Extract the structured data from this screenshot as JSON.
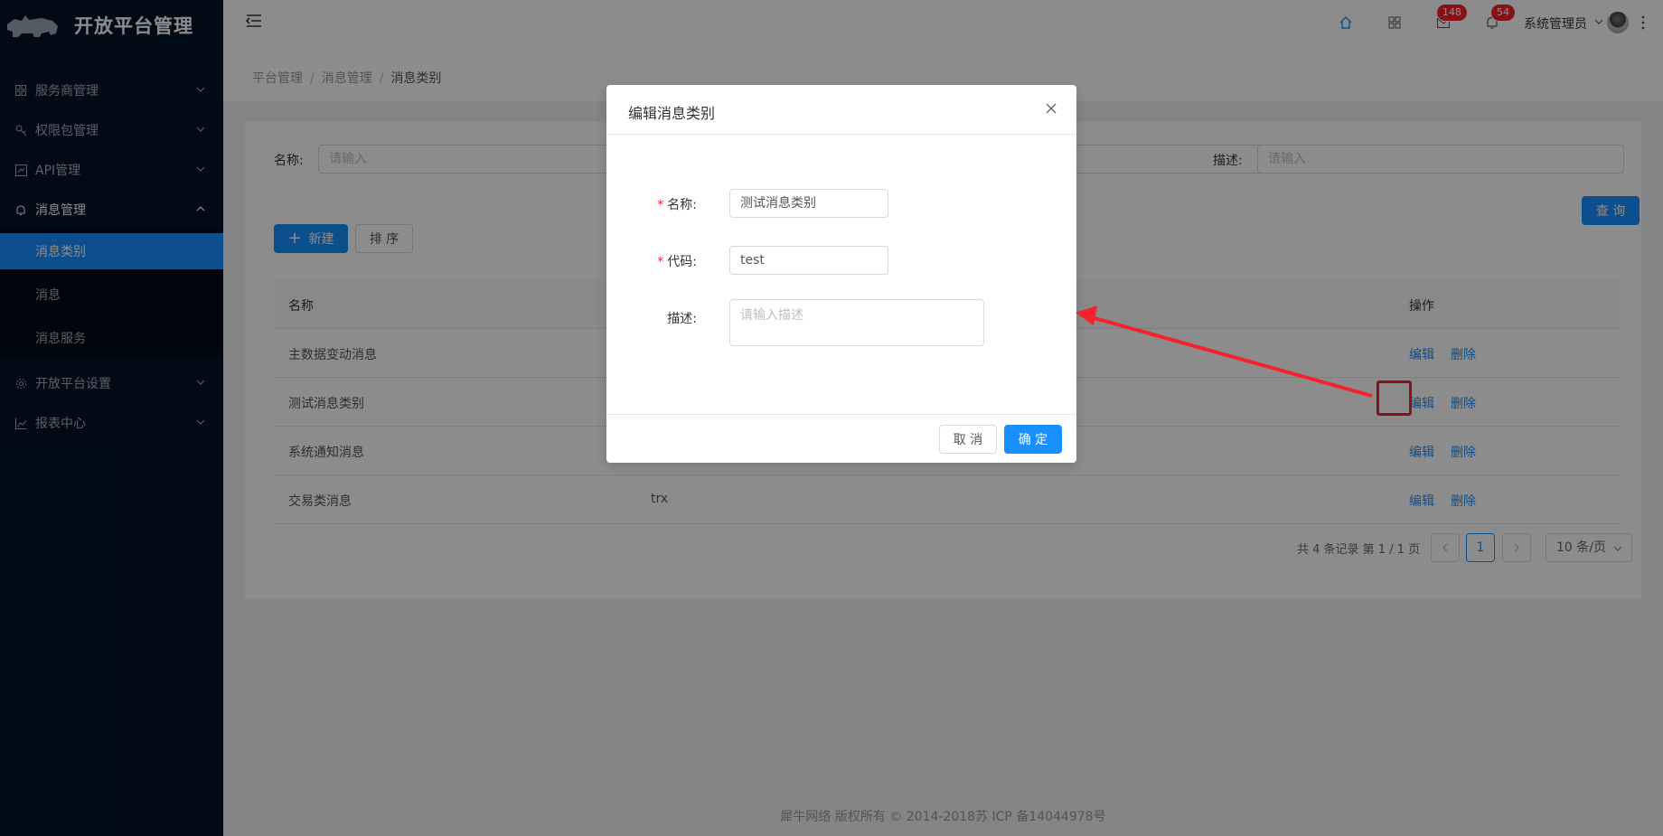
{
  "app": {
    "title": "开放平台管理"
  },
  "sidebar": {
    "items": [
      {
        "label": "服务商管理",
        "icon": "apps-icon"
      },
      {
        "label": "权限包管理",
        "icon": "key-icon"
      },
      {
        "label": "API管理",
        "icon": "api-icon"
      },
      {
        "label": "消息管理",
        "icon": "bell-icon"
      },
      {
        "label": "开放平台设置",
        "icon": "gear-icon"
      },
      {
        "label": "报表中心",
        "icon": "chart-icon"
      }
    ],
    "subitems": [
      {
        "label": "消息类别"
      },
      {
        "label": "消息"
      },
      {
        "label": "消息服务"
      }
    ]
  },
  "header": {
    "mail_badge": "148",
    "bell_badge": "54",
    "user": "系统管理员"
  },
  "breadcrumb": [
    "平台管理",
    "消息管理",
    "消息类别"
  ],
  "filters": {
    "name_label": "名称:",
    "name_placeholder": "请输入",
    "desc_label": "描述:",
    "desc_placeholder": "请输入",
    "query": "查 询"
  },
  "toolbar": {
    "new": "新建",
    "sort": "排 序"
  },
  "table": {
    "columns": [
      "名称",
      "操作"
    ],
    "rows": [
      {
        "name": "主数据变动消息",
        "code": ""
      },
      {
        "name": "测试消息类别",
        "code": ""
      },
      {
        "name": "系统通知消息",
        "code": ""
      },
      {
        "name": "交易类消息",
        "code": "trx"
      }
    ],
    "edit": "编辑",
    "delete": "删除"
  },
  "pagination": {
    "summary": "共 4 条记录 第 1 / 1 页",
    "current": "1",
    "page_size": "10 条/页"
  },
  "footer": "犀牛网络 版权所有 © 2014-2018苏 ICP 备14044978号",
  "modal": {
    "title": "编辑消息类别",
    "name_label": "名称:",
    "name_value": "测试消息类别",
    "code_label": "代码:",
    "code_value": "test",
    "desc_label": "描述:",
    "desc_placeholder": "请输入描述",
    "cancel": "取 消",
    "ok": "确 定"
  },
  "colors": {
    "primary": "#1890ff",
    "sidebar": "#001529",
    "danger": "#f5222d"
  }
}
